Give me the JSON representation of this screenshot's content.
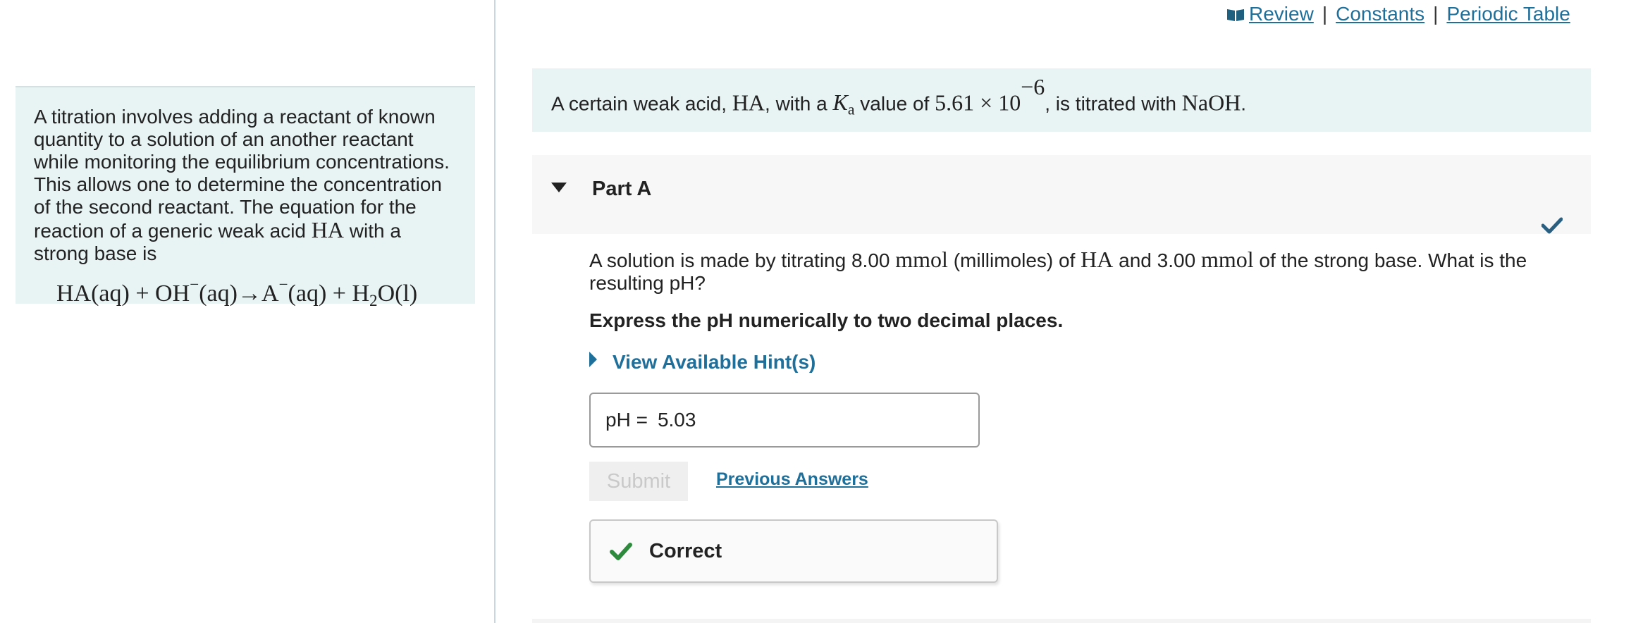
{
  "top_links": {
    "review": "Review",
    "constants": "Constants",
    "periodic_table": "Periodic Table",
    "separator": "|"
  },
  "intro": {
    "text_before": "A titration involves adding a reactant of known quantity to a solution of an another reactant while monitoring the equilibrium concentrations. This allows one to determine the concentration of the second reactant. The equation for the reaction of a generic weak acid ",
    "acid": "HA",
    "text_after": " with a strong base is",
    "eq": {
      "reactant1": "HA(aq)",
      "plus1": " + ",
      "reactant2_base": "OH",
      "reactant2_sup": "−",
      "reactant2_state": "(aq)",
      "arrow": "→",
      "product1_base": "A",
      "product1_sup": "−",
      "product1_state": "(aq)",
      "plus2": " + ",
      "product2_h": "H",
      "product2_sub": "2",
      "product2_rest": "O(l)"
    }
  },
  "statement": {
    "t1": "A certain weak acid, ",
    "acid": "HA",
    "t2": ", with a ",
    "k": "K",
    "k_sub": "a",
    "t3": " value of ",
    "value": "5.61 × 10",
    "exp": "−6",
    "t4": ", is titrated with ",
    "base": "NaOH",
    "t5": "."
  },
  "part": {
    "title": "Part A",
    "question": {
      "t1": "A solution is made by titrating 8.00 ",
      "unit1": "mmol",
      "t2": " (millimoles) of ",
      "acid": "HA",
      "t3": " and 3.00 ",
      "unit2": "mmol",
      "t4": " of the strong base. What is the resulting pH?"
    },
    "instruction": "Express the pH numerically to two decimal places.",
    "hint_label": "View Available Hint(s)",
    "answer": {
      "label": "pH =",
      "value": "5.03"
    },
    "submit_label": "Submit",
    "previous_answers": "Previous Answers",
    "feedback": "Correct"
  },
  "colors": {
    "link": "#1f6f9b",
    "panel_bg": "#e8f3f3",
    "correct_green": "#2e8b3e",
    "header_check": "#2a5f7f"
  },
  "icons": {
    "review": "book-icon",
    "part_toggle": "caret-down-icon",
    "part_status": "checkmark-icon",
    "hint_toggle": "caret-right-icon",
    "feedback": "checkmark-icon"
  }
}
